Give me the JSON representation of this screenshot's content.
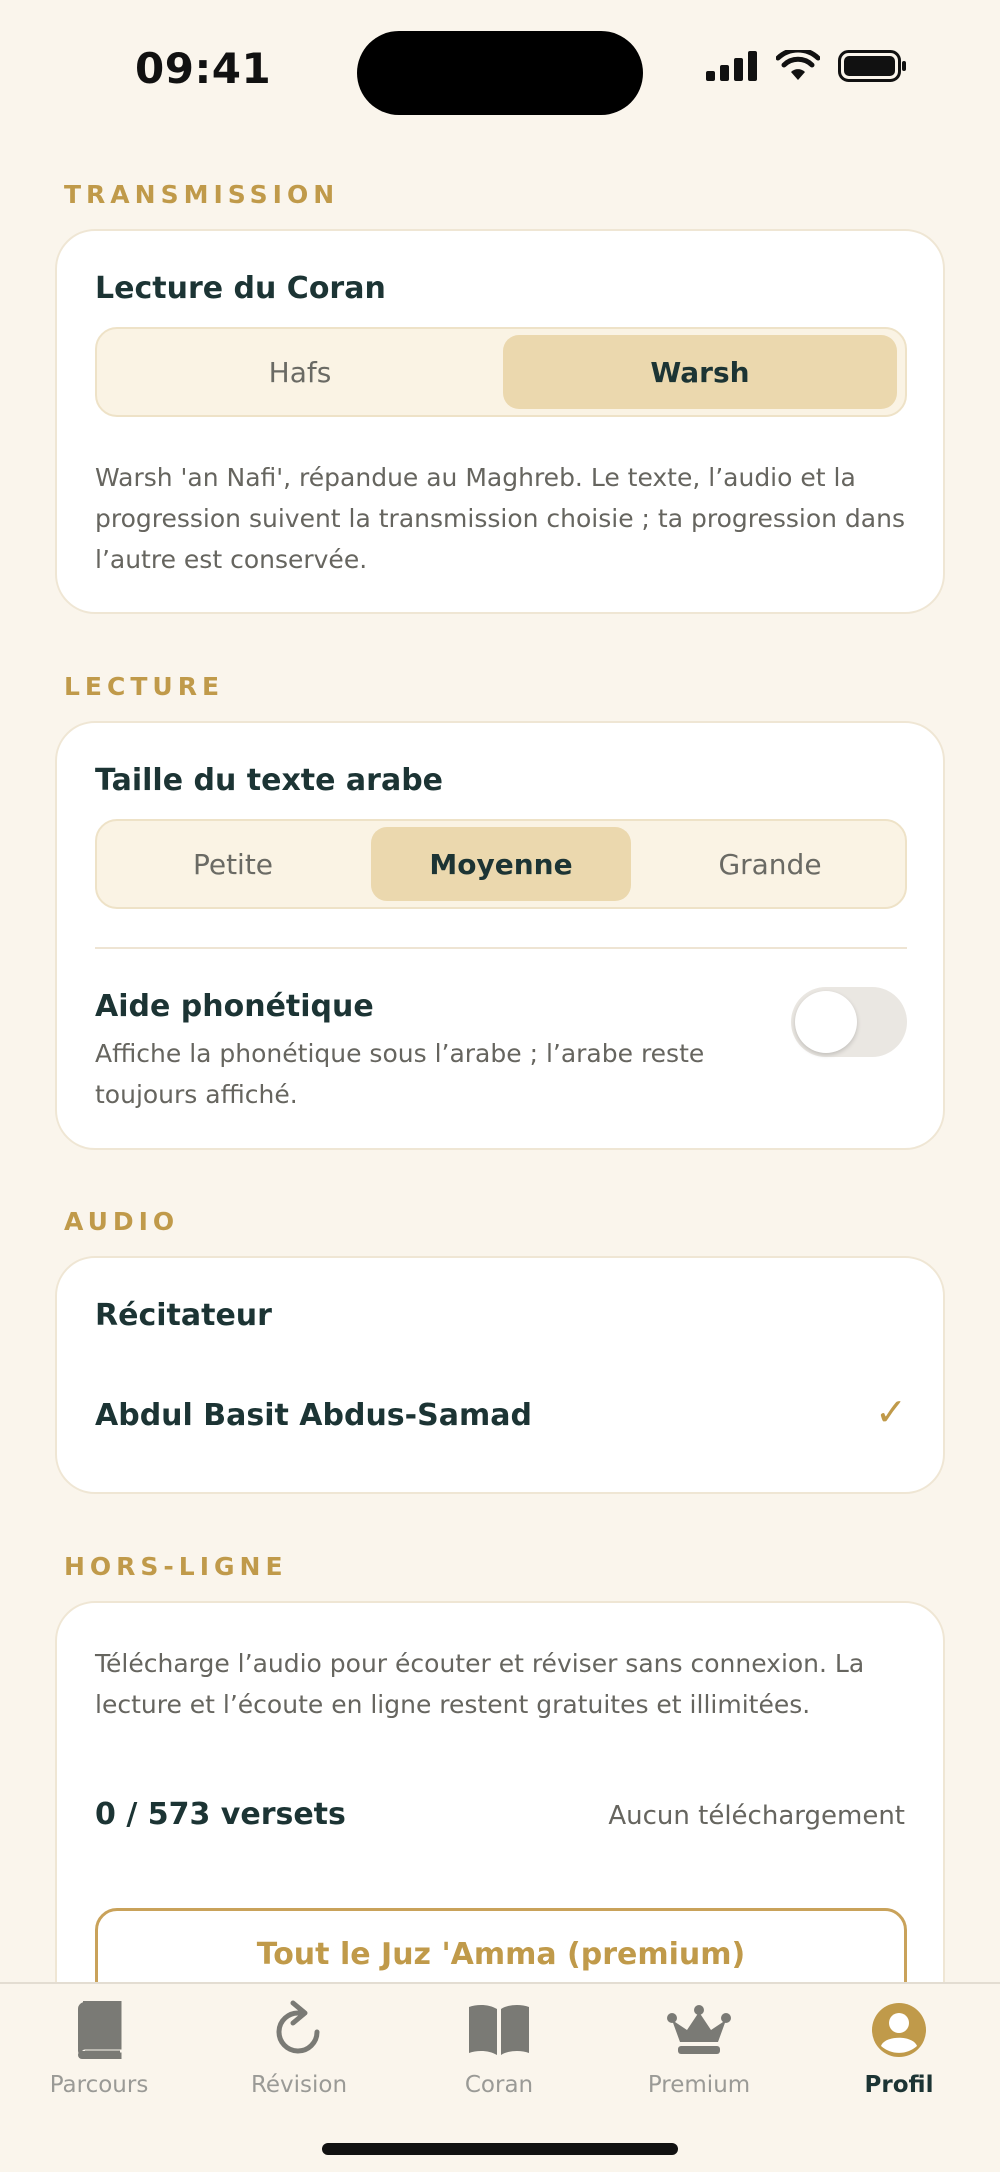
{
  "status_bar": {
    "time": "09:41"
  },
  "transmission": {
    "section_label": "TRANSMISSION",
    "title": "Lecture du Coran",
    "options": [
      "Hafs",
      "Warsh"
    ],
    "selected": "Warsh",
    "description": "Warsh 'an Nafi', répandue au Maghreb. Le texte, l’audio et la progression suivent la transmission choisie ; ta progression dans l’autre est conservée."
  },
  "lecture": {
    "section_label": "LECTURE",
    "text_size_title": "Taille du texte arabe",
    "sizes": [
      "Petite",
      "Moyenne",
      "Grande"
    ],
    "selected": "Moyenne",
    "phonetic_title": "Aide phonétique",
    "phonetic_description": "Affiche la phonétique sous l’arabe ; l’arabe reste toujours affiché.",
    "phonetic_enabled": false
  },
  "audio": {
    "section_label": "AUDIO",
    "reciter_title": "Récitateur",
    "reciter_name": "Abdul Basit Abdus-Samad",
    "reciter_selected_mark": "✓"
  },
  "offline": {
    "section_label": "HORS-LIGNE",
    "description": "Télécharge l’audio pour écouter et réviser sans connexion. La lecture et l’écoute en ligne restent gratuites et illimitées.",
    "verses_count": "0 / 573 versets",
    "download_status": "Aucun téléchargement",
    "download_button": "Tout le Juz 'Amma (premium)"
  },
  "tabbar": {
    "items": [
      {
        "label": "Parcours",
        "icon": "book-icon"
      },
      {
        "label": "Révision",
        "icon": "refresh-icon"
      },
      {
        "label": "Coran",
        "icon": "open-book-icon"
      },
      {
        "label": "Premium",
        "icon": "crown-icon"
      },
      {
        "label": "Profil",
        "icon": "profile-icon"
      }
    ],
    "active": "Profil"
  },
  "colors": {
    "background": "#FAF5EC",
    "accent_gold": "#C09A4A",
    "selected_segment": "#EBD8AE",
    "text_dark": "#1C3434"
  }
}
